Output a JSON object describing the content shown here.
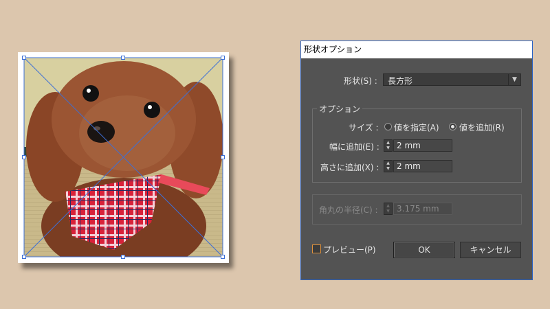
{
  "dialog": {
    "title": "形状オプション",
    "shape_label": "形状(S) :",
    "shape_value": "長方形",
    "options_group_title": "オプション",
    "size_label": "サイズ :",
    "size_options": [
      "値を指定(A)",
      "値を追加(R)"
    ],
    "size_selected": "値を追加(R)",
    "width_label": "幅に追加(E) :",
    "width_value": "2 mm",
    "height_label": "高さに追加(X) :",
    "height_value": "2 mm",
    "corner_label": "角丸の半径(C) :",
    "corner_value": "3.175 mm",
    "preview_label": "プレビュー(P)",
    "preview_checked": false,
    "ok_label": "OK",
    "cancel_label": "キャンセル"
  },
  "colors": {
    "background": "#dcc6ad",
    "dialog_bg": "#535353",
    "selection": "#3d6fd6",
    "checkbox_accent": "#e0913a"
  },
  "artboard": {
    "subject": "dog photo with red plaid bandana",
    "selected": true
  }
}
